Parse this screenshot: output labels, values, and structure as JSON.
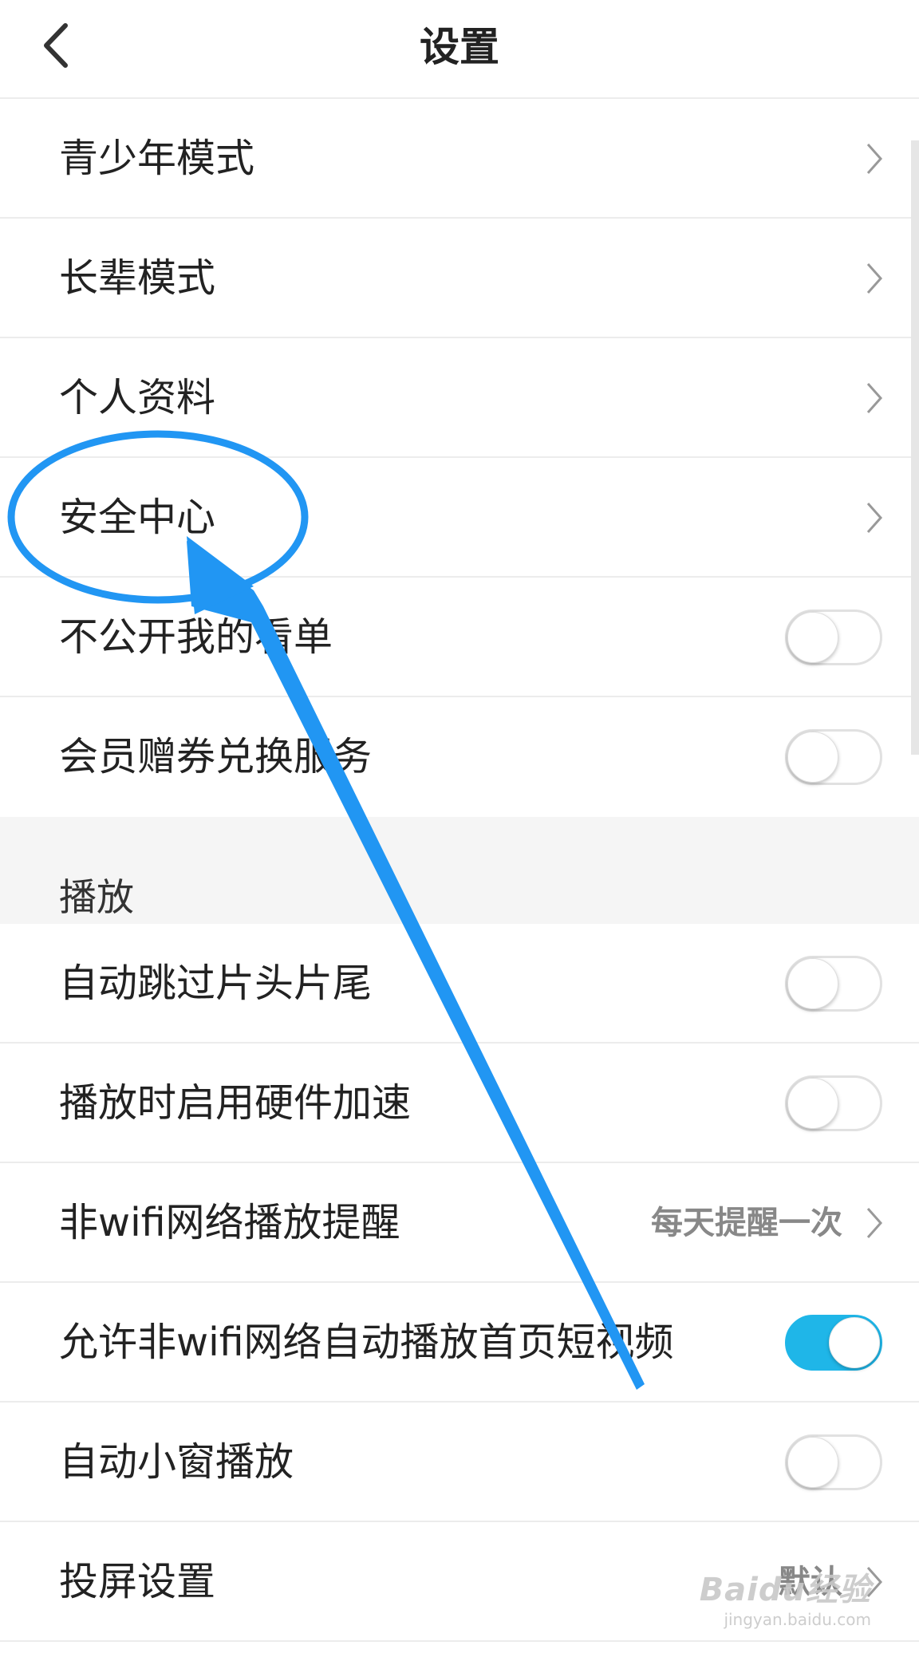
{
  "header": {
    "title": "设置",
    "back_icon": "chevron-left-icon"
  },
  "rows_top": [
    {
      "label": "青少年模式",
      "type": "link"
    },
    {
      "label": "长辈模式",
      "type": "link"
    },
    {
      "label": "个人资料",
      "type": "link"
    },
    {
      "label": "安全中心",
      "type": "link"
    },
    {
      "label": "不公开我的看单",
      "type": "toggle",
      "on": false
    },
    {
      "label": "会员赠券兑换服务",
      "type": "toggle",
      "on": false
    }
  ],
  "section_playback": {
    "label": "播放"
  },
  "rows_playback": [
    {
      "label": "自动跳过片头片尾",
      "type": "toggle",
      "on": false
    },
    {
      "label": "播放时启用硬件加速",
      "type": "toggle",
      "on": false
    },
    {
      "label": "非wifi网络播放提醒",
      "type": "link",
      "value": "每天提醒一次"
    },
    {
      "label": "允许非wifi网络自动播放首页短视频",
      "type": "toggle",
      "on": true
    },
    {
      "label": "自动小窗播放",
      "type": "toggle",
      "on": false
    },
    {
      "label": "投屏设置",
      "type": "link",
      "value": "默认"
    }
  ],
  "watermark": {
    "logo": "Baidu经验",
    "url": "jingyan.baidu.com"
  },
  "colors": {
    "accent": "#1fb6e8",
    "annotation": "#2196f3",
    "divider": "#ececec",
    "section_bg": "#f5f5f5"
  }
}
